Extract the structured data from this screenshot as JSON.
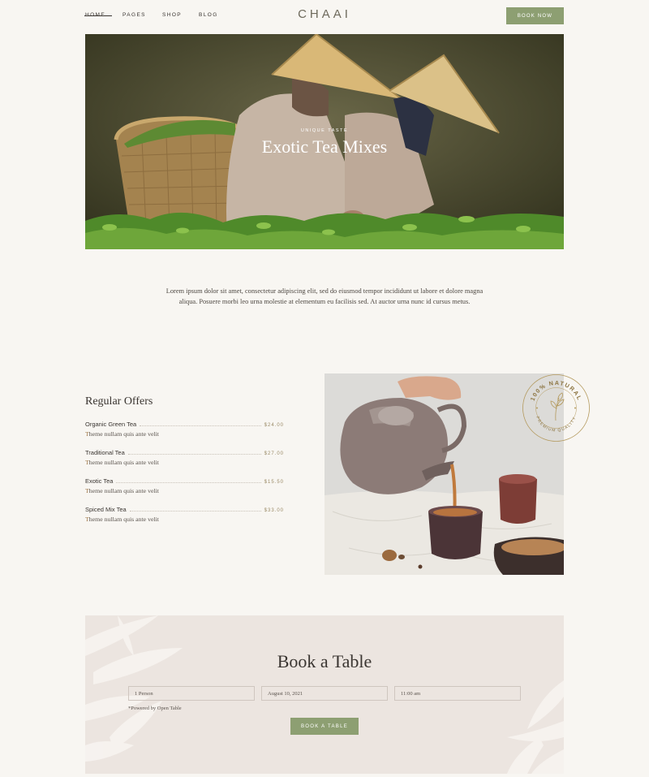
{
  "nav": {
    "home": "Home",
    "pages": "Pages",
    "shop": "Shop",
    "blog": "Blog"
  },
  "logo": "CHAAI",
  "header": {
    "book_now": "Book Now"
  },
  "hero": {
    "subtitle": "Unique Taste",
    "title": "Exotic Tea Mixes"
  },
  "intro": {
    "text": "Lorem ipsum dolor sit amet, consectetur adipiscing elit, sed do eiusmod tempor incididunt ut labore et dolore magna aliqua. Posuere morbi leo urna molestie at elementum eu facilisis sed. At auctor urna nunc id cursus metus."
  },
  "offers": {
    "title": "Regular Offers",
    "items": [
      {
        "name": "Organic Green Tea",
        "price": "$24.00",
        "desc_first": "T",
        "desc_rest": "heme nullam quis ante velit"
      },
      {
        "name": "Traditional Tea",
        "price": "$27.00",
        "desc_first": "T",
        "desc_rest": "heme nullam quis ante velit"
      },
      {
        "name": "Exotic Tea",
        "price": "$15.50",
        "desc_first": "T",
        "desc_rest": "heme nullam quis ante velit"
      },
      {
        "name": "Spiced Mix Tea",
        "price": "$33.00",
        "desc_first": "T",
        "desc_rest": "heme nullam quis ante velit"
      }
    ]
  },
  "badge": {
    "top_text": "100% NATURAL",
    "bottom_text": "PREMIUM QUALITY"
  },
  "booking": {
    "title": "Book a Table",
    "party": "1 Person",
    "date": "August 10, 2021",
    "time": "11:00 am",
    "powered": "*Powered by Open Table",
    "button": "Book a Table"
  },
  "colors": {
    "accent": "#8d9f72",
    "background": "#f8f6f2",
    "booking_bg": "#ece5e0",
    "price": "#9a8a66"
  }
}
